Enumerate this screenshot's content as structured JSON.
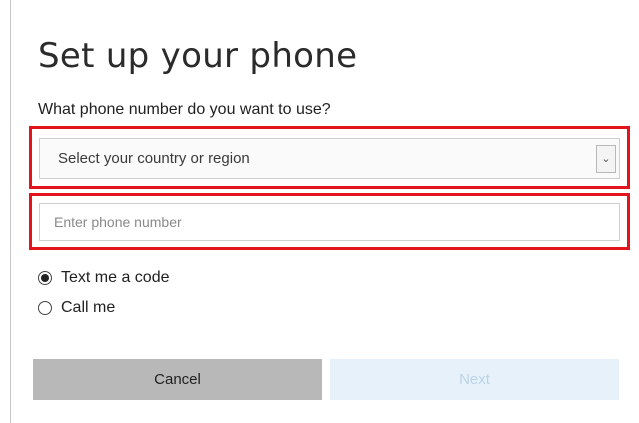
{
  "page": {
    "title": "Set up your phone",
    "question": "What phone number do you want to use?"
  },
  "country_select": {
    "value": "Select your country or region"
  },
  "phone_input": {
    "placeholder": "Enter phone number"
  },
  "verification_options": [
    {
      "label": "Text me a code",
      "selected": true
    },
    {
      "label": "Call me",
      "selected": false
    }
  ],
  "buttons": {
    "cancel_label": "Cancel",
    "next_label": "Next"
  },
  "colors": {
    "highlight": "#e2151f",
    "cancel_bg": "#b8b8b8",
    "next_bg_disabled": "#e7f1fa"
  }
}
